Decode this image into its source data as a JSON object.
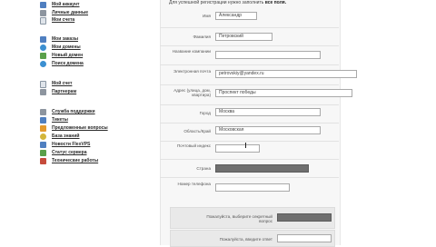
{
  "sidebar": {
    "groups": [
      {
        "items": [
          {
            "label": "Мой аккаунт",
            "icon": "user-icon"
          },
          {
            "label": "Личные данные",
            "icon": "id-card-icon"
          },
          {
            "label": "Мои счета",
            "icon": "invoice-icon"
          }
        ]
      },
      {
        "items": [
          {
            "label": "Мои заказы",
            "icon": "orders-icon"
          },
          {
            "label": "Мои домены",
            "icon": "globe-icon"
          },
          {
            "label": "Новый домен",
            "icon": "new-domain-icon"
          },
          {
            "label": "Поиск домена",
            "icon": "search-icon"
          }
        ]
      },
      {
        "items": [
          {
            "label": "Мой счет",
            "icon": "wallet-icon"
          },
          {
            "label": "Партнерам",
            "icon": "partners-icon"
          }
        ]
      },
      {
        "items": [
          {
            "label": "Служба поддержки",
            "icon": "support-icon"
          },
          {
            "label": "Тикеты",
            "icon": "ticket-icon"
          },
          {
            "label": "Предложенные вопросы",
            "icon": "faq-icon"
          },
          {
            "label": "База знаний",
            "icon": "knowledge-icon"
          },
          {
            "label": "Новости FlexVPS",
            "icon": "news-icon"
          },
          {
            "label": "Статус сервера",
            "icon": "server-status-icon"
          },
          {
            "label": "Технические работы",
            "icon": "maintenance-icon"
          }
        ]
      }
    ]
  },
  "form": {
    "intro_text": "Для успешной регистрации нужно заполнить",
    "intro_bold": "все поля.",
    "fields": [
      {
        "label": "Имя",
        "value": "Александр"
      },
      {
        "label": "Фамилия",
        "value": "Петровский"
      },
      {
        "label": "Название компании",
        "value": ""
      },
      {
        "label": "Электронная почта",
        "value": "petrovskiy@yandex.ru"
      },
      {
        "label": "Адрес (улица, дом, квартира)",
        "value": "Проспект победы"
      },
      {
        "label": "Город",
        "value": "Москва"
      },
      {
        "label": "Область/Край",
        "value": "Московская"
      },
      {
        "label": "Почтовый индекс",
        "value": ""
      },
      {
        "label": "Страна",
        "value": ""
      },
      {
        "label": "Номер телефона",
        "value": ""
      }
    ],
    "security": {
      "question_label": "Пожалуйста, выберите секретный вопрос",
      "answer_label": "Пожалуйста, введите ответ"
    }
  }
}
